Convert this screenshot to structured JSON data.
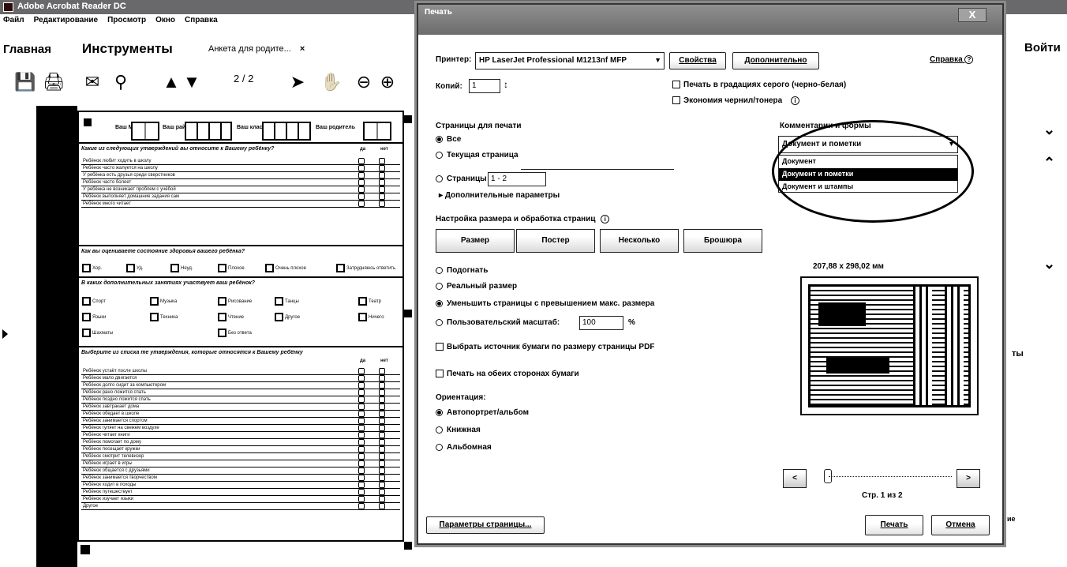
{
  "app": {
    "title": "Adobe Acrobat Reader DC",
    "menu": [
      "Файл",
      "Редактирование",
      "Просмотр",
      "Окно",
      "Справка"
    ],
    "tabs": {
      "home": "Главная",
      "tools": "Инструменты",
      "document": "Анкета для родите...",
      "close": "×"
    },
    "login": "Войти",
    "page_current": "2",
    "page_total": "/ 2",
    "right_fragment_1": "ты",
    "right_fragment_2": "ие"
  },
  "doc": {
    "header_labels": [
      "Ваш МО",
      "Ваш район",
      "Ваш класс",
      "Ваш родитель"
    ],
    "col_yes": "да",
    "col_no": "нет",
    "q1": {
      "title": "Какие из следующих утверждений вы относите к Вашему ребёнку?",
      "rows": [
        "Ребёнок любит ходить в школу",
        "Ребёнок часто жалуется на школу",
        "У ребёнка есть друзья среди сверстников",
        "Ребёнок часто болеет",
        "У ребёнка не возникает проблем с учёбой",
        "Ребёнок выполняет домашние задания сам",
        "Ребёнок много читает"
      ]
    },
    "q2": {
      "title": "Как вы оцениваете состояние здоровья вашего ребёнка?",
      "options": [
        "Хор.",
        "Уд.",
        "Неуд.",
        "Плохое",
        "Очень плохое",
        "Затрудняюсь ответить"
      ]
    },
    "q3": {
      "title": "В каких дополнительных занятиях участвует ваш ребёнок?",
      "options": [
        "Спорт",
        "Музыка",
        "Рисование",
        "Танцы",
        "Театр",
        "Языки",
        "Техника",
        "Чтение",
        "Другое",
        "Ничего",
        "Шахматы",
        "Без ответа"
      ]
    },
    "q4": {
      "title": "Выберите из списка те утверждения, которые относятся к Вашему ребёнку",
      "rows": [
        "Ребёнок устаёт после школы",
        "Ребёнок мало двигается",
        "Ребёнок долго сидит за компьютером",
        "Ребёнок рано ложится спать",
        "Ребёнок поздно ложится спать",
        "Ребёнок завтракает дома",
        "Ребёнок обедает в школе",
        "Ребёнок занимается спортом",
        "Ребёнок гуляет на свежем воздухе",
        "Ребёнок читает книги",
        "Ребёнок помогает по дому",
        "Ребёнок посещает кружки",
        "Ребёнок смотрит телевизор",
        "Ребёнок играет в игры",
        "Ребёнок общается с друзьями",
        "Ребёнок занимается творчеством",
        "Ребёнок ходит в походы",
        "Ребёнок путешествует",
        "Ребёнок изучает языки",
        "Другое"
      ]
    }
  },
  "dialog": {
    "title": "Печать",
    "close": "X",
    "printer_label": "Принтер:",
    "printer_value": "HP LaserJet Professional M1213nf MFP",
    "btn_properties": "Свойства",
    "btn_advanced": "Дополнительно",
    "help_link": "Справка",
    "copies_label": "Копий:",
    "copies_value": "1",
    "grayscale_label": "Печать в градациях серого (черно-белая)",
    "save_ink_label": "Экономия чернил/тонера",
    "pages_section": "Страницы для печати",
    "opt_all": "Все",
    "opt_current": "Текущая страница",
    "opt_pages": "Страницы",
    "pages_value": "1 - 2",
    "more_options": "Дополнительные параметры",
    "comments_section": "Комментарии и формы",
    "comments_selected": "Документ и пометки",
    "comments_options": [
      "Документ",
      "Документ и пометки",
      "Документ и штампы"
    ],
    "size_section": "Настройка размера и обработка страниц",
    "btn_size": "Размер",
    "btn_poster": "Постер",
    "btn_multiple": "Несколько",
    "btn_booklet": "Брошюра",
    "opt_fit": "Подогнать",
    "opt_actual": "Реальный размер",
    "opt_shrink": "Уменьшить страницы с превышением макс. размера",
    "opt_custom": "Пользовательский масштаб:",
    "custom_value": "100",
    "custom_unit": "%",
    "paper_source": "Выбрать источник бумаги по размеру страницы PDF",
    "duplex": "Печать на обеих сторонах бумаги",
    "orientation_section": "Ориентация:",
    "opt_auto": "Автопортрет/альбом",
    "opt_portrait": "Книжная",
    "opt_landscape": "Альбомная",
    "preview_size": "207,88 x 298,02 мм",
    "nav_prev": "<",
    "nav_next": ">",
    "page_of": "Стр. 1 из 2",
    "btn_page_setup": "Параметры страницы...",
    "btn_print": "Печать",
    "btn_cancel": "Отмена"
  }
}
